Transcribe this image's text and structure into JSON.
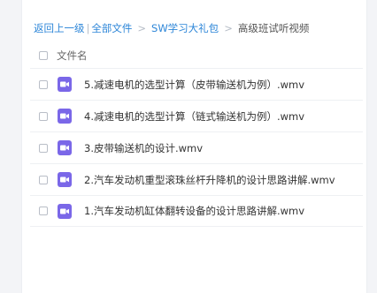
{
  "breadcrumb": {
    "back": "返回上一级",
    "pipe": "|",
    "all_files": "全部文件",
    "sep1": ">",
    "folder": "SW学习大礼包",
    "sep2": ">",
    "current": "高级班试听视频"
  },
  "table": {
    "column_name": "文件名",
    "file_icon": "video-file-icon",
    "accent_color": "#7a67e8",
    "rows": [
      {
        "name": "5.减速电机的选型计算（皮带输送机为例）.wmv"
      },
      {
        "name": "4.减速电机的选型计算（链式输送机为例）.wmv"
      },
      {
        "name": "3.皮带输送机的设计.wmv"
      },
      {
        "name": "2.汽车发动机重型滚珠丝杆升降机的设计思路讲解.wmv"
      },
      {
        "name": "1.汽车发动机缸体翻转设备的设计思路讲解.wmv"
      }
    ]
  }
}
